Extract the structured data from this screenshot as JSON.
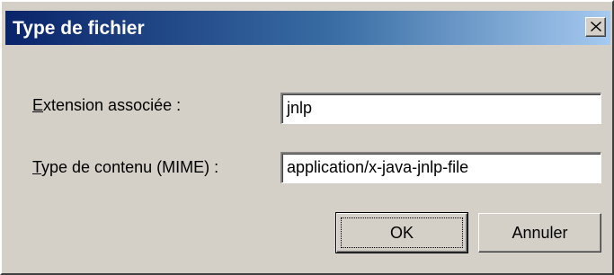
{
  "dialog": {
    "title": "Type de fichier",
    "close_icon": "close-x-icon"
  },
  "fields": {
    "extension": {
      "label_accel": "E",
      "label_rest": "xtension associée :",
      "value": "jnlp"
    },
    "mime": {
      "label_accel": "T",
      "label_rest": "ype de contenu (MIME) :",
      "value": "application/x-java-jnlp-file"
    }
  },
  "buttons": {
    "ok": "OK",
    "cancel": "Annuler"
  }
}
